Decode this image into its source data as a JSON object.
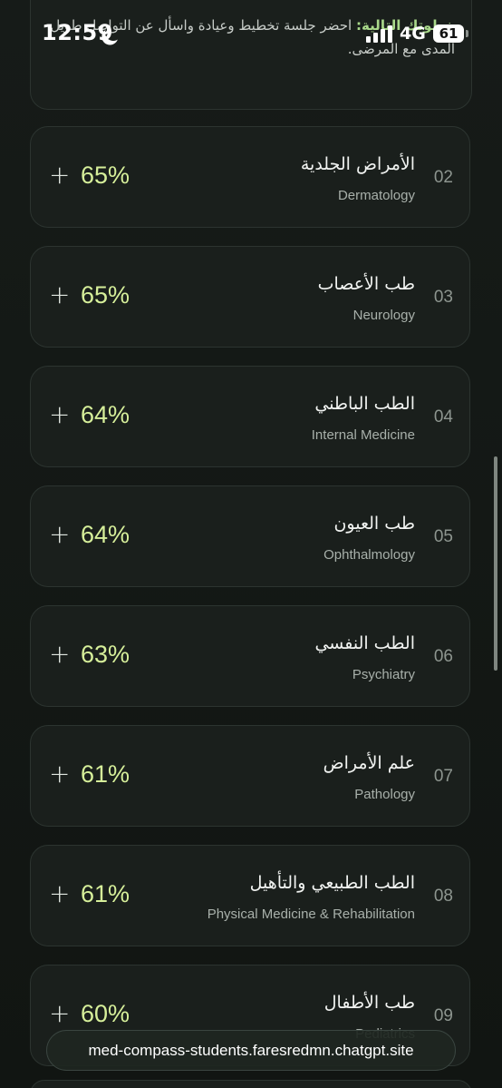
{
  "status_bar": {
    "time": "12:59",
    "network": "4G",
    "battery": "61"
  },
  "top_card": {
    "lead": "خطوتك التالية:",
    "text": "احضر جلسة تخطيط وعيادة واسأل عن التواصل طويل المدى مع المرضى."
  },
  "specialties": [
    {
      "num": "02",
      "name_ar": "الأمراض الجلدية",
      "name_en": "Dermatology",
      "pct": "65%",
      "expand": "+"
    },
    {
      "num": "03",
      "name_ar": "طب الأعصاب",
      "name_en": "Neurology",
      "pct": "65%",
      "expand": "+"
    },
    {
      "num": "04",
      "name_ar": "الطب الباطني",
      "name_en": "Internal Medicine",
      "pct": "64%",
      "expand": "+"
    },
    {
      "num": "05",
      "name_ar": "طب العيون",
      "name_en": "Ophthalmology",
      "pct": "64%",
      "expand": "+"
    },
    {
      "num": "06",
      "name_ar": "الطب النفسي",
      "name_en": "Psychiatry",
      "pct": "63%",
      "expand": "+"
    },
    {
      "num": "07",
      "name_ar": "علم الأمراض",
      "name_en": "Pathology",
      "pct": "61%",
      "expand": "+"
    },
    {
      "num": "08",
      "name_ar": "الطب الطبيعي والتأهيل",
      "name_en": "Physical Medicine & Rehabilitation",
      "pct": "61%",
      "expand": "+"
    },
    {
      "num": "09",
      "name_ar": "طب الأطفال",
      "name_en": "Pediatrics",
      "pct": "60%",
      "expand": "+"
    }
  ],
  "browser": {
    "url": "med-compass-students.faresredmn.chatgpt.site"
  }
}
